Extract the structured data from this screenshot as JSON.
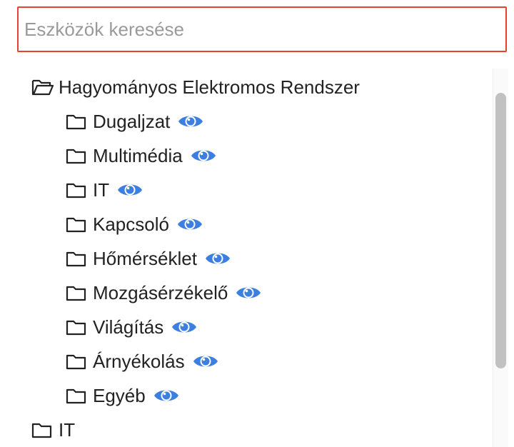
{
  "search": {
    "placeholder": "Eszközök keresése",
    "value": "",
    "border_color": "#e8422a"
  },
  "tree": {
    "root": {
      "label": "Hagyományos Elektromos Rendszer",
      "icon": "folder-open-icon",
      "expanded": true,
      "children": [
        {
          "label": "Dugaljzat",
          "icon": "folder-icon",
          "action_icon": "eye-icon"
        },
        {
          "label": "Multimédia",
          "icon": "folder-icon",
          "action_icon": "eye-icon"
        },
        {
          "label": "IT",
          "icon": "folder-icon",
          "action_icon": "eye-icon"
        },
        {
          "label": "Kapcsoló",
          "icon": "folder-icon",
          "action_icon": "eye-icon"
        },
        {
          "label": "Hőmérséklet",
          "icon": "folder-icon",
          "action_icon": "eye-icon"
        },
        {
          "label": "Mozgásérzékelő",
          "icon": "folder-icon",
          "action_icon": "eye-icon"
        },
        {
          "label": "Világítás",
          "icon": "folder-icon",
          "action_icon": "eye-icon"
        },
        {
          "label": "Árnyékolás",
          "icon": "folder-icon",
          "action_icon": "eye-icon"
        },
        {
          "label": "Egyéb",
          "icon": "folder-icon",
          "action_icon": "eye-icon"
        }
      ]
    },
    "second_root": {
      "label": "IT",
      "icon": "folder-icon",
      "expanded": false
    }
  },
  "colors": {
    "eye": "#3d7fe0",
    "text": "#222222",
    "scrollbar_thumb": "#c1c1c1"
  }
}
